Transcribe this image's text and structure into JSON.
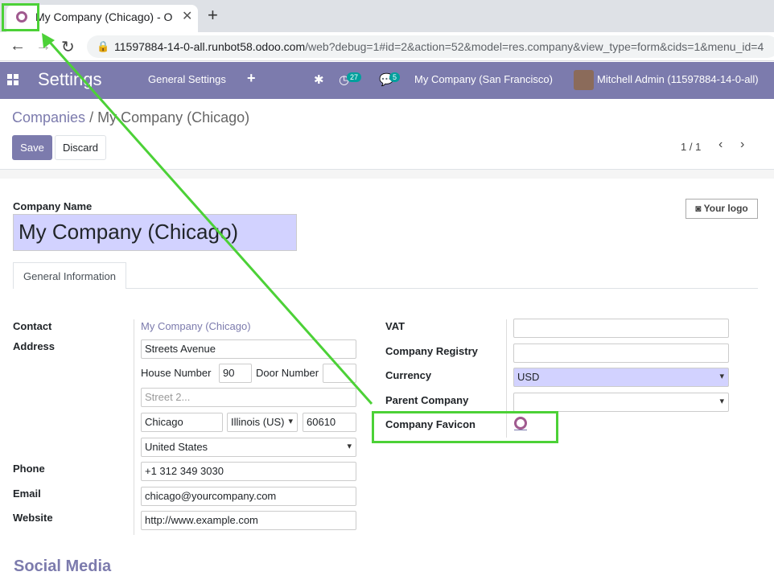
{
  "browser": {
    "tab_title": "My Company (Chicago) - O",
    "url_host": "11597884-14-0-all.runbot58.odoo.com",
    "url_rest": "/web?debug=1#id=2&action=52&model=res.company&view_type=form&cids=1&menu_id=4"
  },
  "navbar": {
    "app_name": "Settings",
    "menu_general": "General Settings",
    "activity_count": "27",
    "message_count": "5",
    "company": "My Company (San Francisco)",
    "user": "Mitchell Admin (11597884-14-0-all)"
  },
  "breadcrumb": {
    "parent": "Companies",
    "separator": "/",
    "current": "My Company (Chicago)"
  },
  "buttons": {
    "save": "Save",
    "discard": "Discard",
    "logo": "Your logo"
  },
  "pager": "1 / 1",
  "form": {
    "company_name_label": "Company Name",
    "company_name": "My Company (Chicago)",
    "tab_general": "General Information",
    "contact_label": "Contact",
    "contact_value": "My Company (Chicago)",
    "address_label": "Address",
    "street": "Streets Avenue",
    "house_number_label": "House Number",
    "house_number": "90",
    "door_number_label": "Door Number",
    "door_number": "",
    "street2_placeholder": "Street 2...",
    "city": "Chicago",
    "state": "Illinois (US)",
    "zip": "60610",
    "country": "United States",
    "phone_label": "Phone",
    "phone": "+1 312 349 3030",
    "email_label": "Email",
    "email": "chicago@yourcompany.com",
    "website_label": "Website",
    "website": "http://www.example.com",
    "vat_label": "VAT",
    "vat": "",
    "registry_label": "Company Registry",
    "registry": "",
    "currency_label": "Currency",
    "currency": "USD",
    "parent_label": "Parent Company",
    "parent": "",
    "favicon_label": "Company Favicon",
    "social_heading": "Social Media"
  },
  "colors": {
    "brand": "#7c7bad",
    "required_bg": "#d2d2ff",
    "annotation": "#4cd137",
    "favicon": "#a05a8f"
  }
}
